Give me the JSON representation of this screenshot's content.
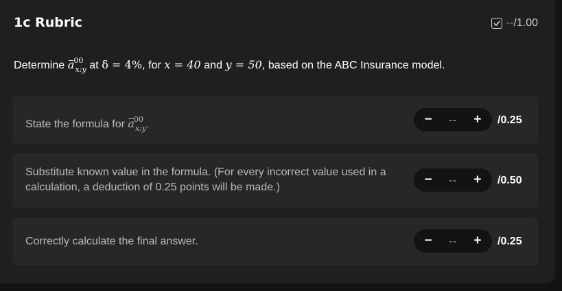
{
  "rubric": {
    "title": "1c Rubric",
    "score_value": "--",
    "score_total": "/1.00"
  },
  "question": {
    "prefix": "Determine",
    "symbol_a": "a",
    "symbol_sup": "00",
    "symbol_sub": "x:y",
    "at_text": "at",
    "delta_expr": "δ = 4%",
    "for_text": ", for",
    "x_expr": "x = 40",
    "and_text": "and",
    "y_expr": "y = 50",
    "suffix": ", based on the ABC Insurance model."
  },
  "items": [
    {
      "text_prefix": "State the formula for",
      "symbol_a": "a",
      "symbol_sup": "00",
      "symbol_sub": "x:y",
      "text_suffix": ".",
      "minus": "−",
      "value": "--",
      "plus": "+",
      "max": "/0.25"
    },
    {
      "text": "Substitute known value in the formula. (For every incorrect value used in a calculation, a deduction of 0.25 points will be made.)",
      "minus": "−",
      "value": "--",
      "plus": "+",
      "max": "/0.50"
    },
    {
      "text": "Correctly calculate the final answer.",
      "minus": "−",
      "value": "--",
      "plus": "+",
      "max": "/0.25"
    }
  ],
  "icons": {
    "rubric_status": "checkbox-checked-icon"
  },
  "colors": {
    "accent": "#8f87d8",
    "card": "#1f1f20",
    "item": "#272728",
    "stepper": "#131314"
  }
}
